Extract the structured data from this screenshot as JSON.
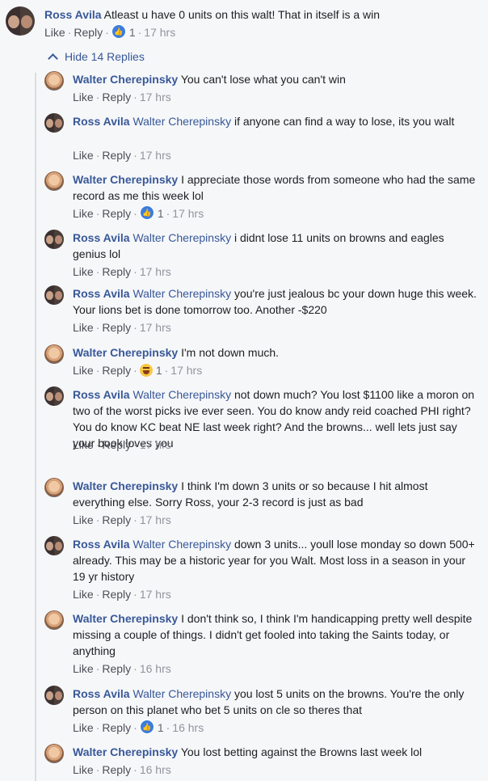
{
  "top_comment": {
    "author": "Ross Avila",
    "text": "Atleast u have 0 units on this walt! That in itself is a win",
    "like_label": "Like",
    "reply_label": "Reply",
    "reaction": "like",
    "reaction_count": "1",
    "time": "17 hrs"
  },
  "replies_toggle": "Hide 14 Replies",
  "replies": [
    {
      "author": "Walter Cherepinsky",
      "mention": "",
      "text": "You can't lose what you can't win",
      "like": "Like",
      "reply": "Reply",
      "reaction": "",
      "reaction_count": "",
      "time": "17 hrs",
      "avatar": "walter"
    },
    {
      "author": "Ross Avila",
      "mention": "Walter Cherepinsky",
      "text": "if anyone can find a way to lose, its you walt",
      "like": "Like",
      "reply": "Reply",
      "reaction": "",
      "reaction_count": "",
      "time": "17 hrs",
      "avatar": "ross"
    },
    {
      "author": "Walter Cherepinsky",
      "mention": "",
      "text": "I appreciate those words from someone who had the same record as me this week lol",
      "like": "Like",
      "reply": "Reply",
      "reaction": "like",
      "reaction_count": "1",
      "time": "17 hrs",
      "avatar": "walter"
    },
    {
      "author": "Ross Avila",
      "mention": "Walter Cherepinsky",
      "text": "i didnt lose 11 units on browns and eagles genius lol",
      "like": "Like",
      "reply": "Reply",
      "reaction": "",
      "reaction_count": "",
      "time": "17 hrs",
      "avatar": "ross"
    },
    {
      "author": "Ross Avila",
      "mention": "Walter Cherepinsky",
      "text": "you're just jealous bc your down huge this week. Your lions bet is done tomorrow too. Another -$220",
      "like": "Like",
      "reply": "Reply",
      "reaction": "",
      "reaction_count": "",
      "time": "17 hrs",
      "avatar": "ross"
    },
    {
      "author": "Walter Cherepinsky",
      "mention": "",
      "text": "I'm not down much.",
      "like": "Like",
      "reply": "Reply",
      "reaction": "haha",
      "reaction_count": "1",
      "time": "17 hrs",
      "avatar": "walter"
    },
    {
      "author": "Ross Avila",
      "mention": "Walter Cherepinsky",
      "text": "not down much? You lost $1100 like a moron on two of the worst picks ive ever seen. You do know andy reid coached PHI right? You do know KC beat NE last week right? And the browns... well lets just say your book loves you",
      "like": "Like",
      "reply": "Reply",
      "reaction": "",
      "reaction_count": "",
      "time": "17 hrs",
      "avatar": "ross"
    },
    {
      "author": "Walter Cherepinsky",
      "mention": "",
      "text": "I think I'm down 3 units or so because I hit almost everything else. Sorry Ross, your 2-3 record is just as bad",
      "like": "Like",
      "reply": "Reply",
      "reaction": "",
      "reaction_count": "",
      "time": "17 hrs",
      "avatar": "walter"
    },
    {
      "author": "Ross Avila",
      "mention": "Walter Cherepinsky",
      "text": "down 3 units... youll lose monday so down 500+ already. This may be a historic year for you Walt. Most loss in a season in your 19 yr history",
      "like": "Like",
      "reply": "Reply",
      "reaction": "",
      "reaction_count": "",
      "time": "17 hrs",
      "avatar": "ross"
    },
    {
      "author": "Walter Cherepinsky",
      "mention": "",
      "text": "I don't think so, I think I'm handicapping pretty well despite missing a couple of things. I didn't get fooled into taking the Saints today, or anything",
      "like": "Like",
      "reply": "Reply",
      "reaction": "",
      "reaction_count": "",
      "time": "16 hrs",
      "avatar": "walter"
    },
    {
      "author": "Ross Avila",
      "mention": "Walter Cherepinsky",
      "text": "you lost 5 units on the browns. You're the only person on this planet who bet 5 units on cle so theres that",
      "like": "Like",
      "reply": "Reply",
      "reaction": "like",
      "reaction_count": "1",
      "time": "16 hrs",
      "avatar": "ross"
    },
    {
      "author": "Walter Cherepinsky",
      "mention": "",
      "text": "You lost betting against the Browns last week lol",
      "like": "Like",
      "reply": "Reply",
      "reaction": "",
      "reaction_count": "",
      "time": "16 hrs",
      "avatar": "walter"
    }
  ],
  "colors": {
    "link": "#385898",
    "meta": "#90949c",
    "background": "#f6f7f9",
    "reaction_like": "#3b7ddd"
  }
}
